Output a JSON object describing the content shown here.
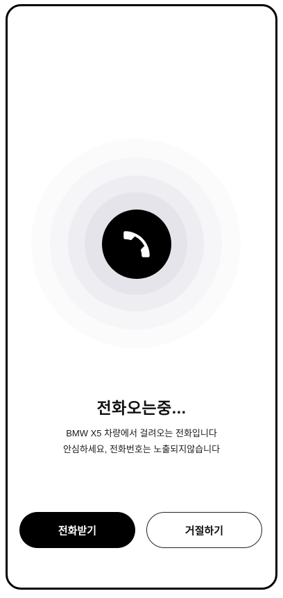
{
  "call": {
    "title": "전화오는중...",
    "description_line1": "BMW X5 차량에서 걸려오는 전화입니다",
    "description_line2": "안심하세요, 전화번호는 노출되지않습니다",
    "icon": "phone-icon"
  },
  "actions": {
    "accept_label": "전화받기",
    "decline_label": "거절하기"
  },
  "colors": {
    "accent": "#000000",
    "background": "#ffffff",
    "ring": "#e4e4ea"
  }
}
